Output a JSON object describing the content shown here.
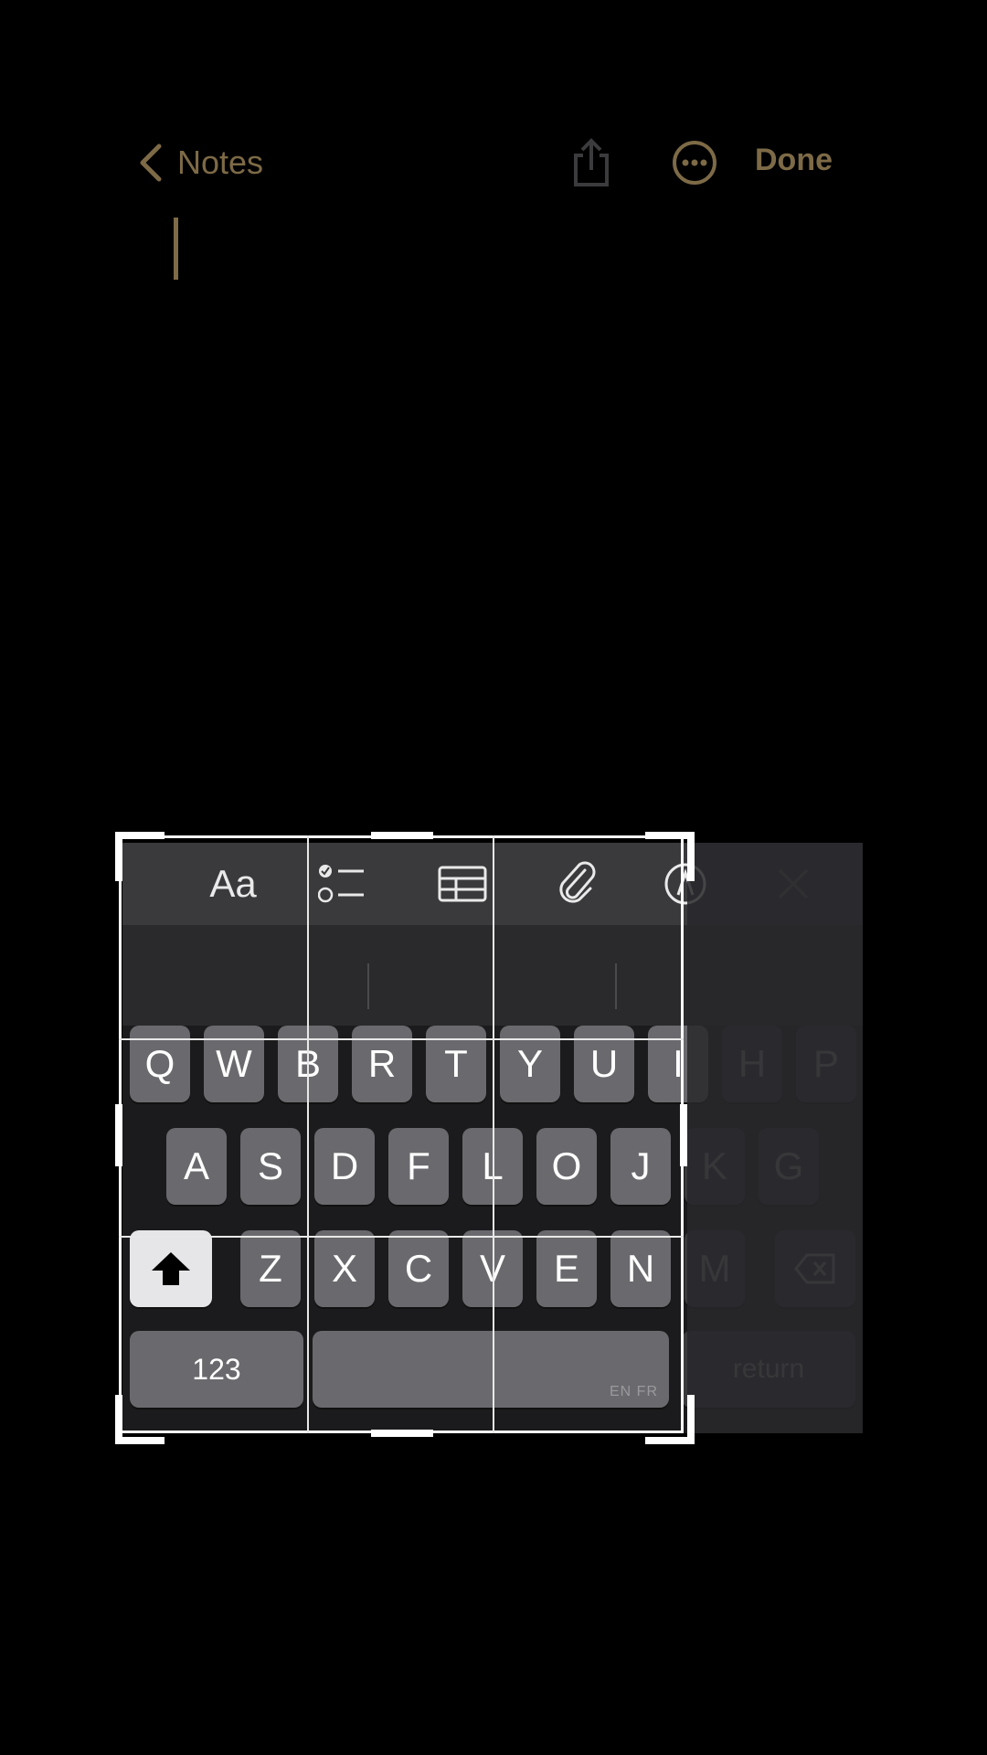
{
  "nav": {
    "back_label": "Notes",
    "done_label": "Done"
  },
  "toolbar": {
    "format_label": "Aa"
  },
  "keyboard": {
    "row1": [
      "Q",
      "W",
      "B",
      "R",
      "T",
      "Y",
      "U",
      "I"
    ],
    "row1_faded": [
      "H",
      "P"
    ],
    "row2": [
      "A",
      "S",
      "D",
      "F",
      "L",
      "O",
      "J"
    ],
    "row2_faded": [
      "K",
      "G"
    ],
    "row3": [
      "Z",
      "X",
      "C",
      "V",
      "E",
      "N"
    ],
    "row3_faded": [
      "M"
    ],
    "numbers_label": "123",
    "space_lang": "EN FR",
    "return_label": "return"
  },
  "colors": {
    "accent": "#7d6a46",
    "key": "#6a6a6e",
    "keyboard_bg": "#1b1b1d"
  },
  "icons": [
    "chevron-left-icon",
    "share-icon",
    "more-icon",
    "checklist-icon",
    "table-icon",
    "paperclip-icon",
    "markup-icon",
    "close-icon",
    "shift-icon",
    "delete-icon"
  ]
}
